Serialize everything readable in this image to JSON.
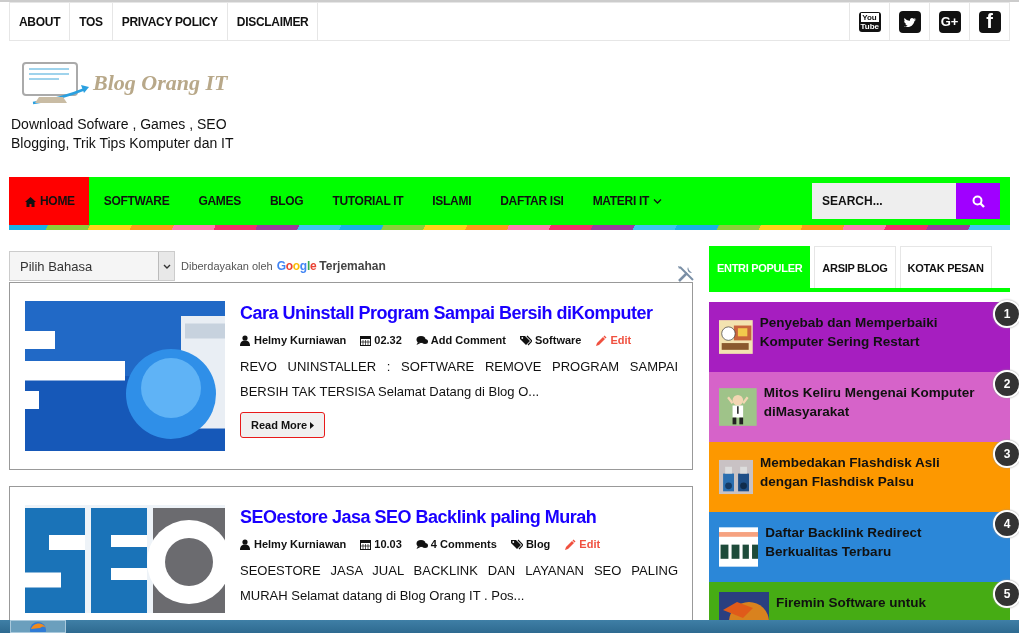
{
  "top_menu": [
    "ABOUT",
    "TOS",
    "PRIVACY POLICY",
    "DISCLAIMER"
  ],
  "social": [
    {
      "kind": "youtube",
      "lines": [
        "You",
        "Tube"
      ]
    },
    {
      "kind": "twitter"
    },
    {
      "kind": "googleplus",
      "text": "G+"
    },
    {
      "kind": "facebook",
      "text": "f"
    }
  ],
  "site": {
    "logo_text": "Blog Orang IT",
    "tagline": "Download Sofware , Games , SEO Blogging, Trik Tips Komputer dan IT"
  },
  "nav": [
    {
      "label": "HOME",
      "selected": true,
      "dropdown": false
    },
    {
      "label": "SOFTWARE",
      "selected": false,
      "dropdown": false
    },
    {
      "label": "GAMES",
      "selected": false,
      "dropdown": false
    },
    {
      "label": "BLOG",
      "selected": false,
      "dropdown": false
    },
    {
      "label": "TUTORIAL IT",
      "selected": false,
      "dropdown": false
    },
    {
      "label": "ISLAMI",
      "selected": false,
      "dropdown": false
    },
    {
      "label": "DAFTAR ISI",
      "selected": false,
      "dropdown": false
    },
    {
      "label": "MATERI IT",
      "selected": false,
      "dropdown": true
    }
  ],
  "search": {
    "placeholder": "SEARCH..."
  },
  "translate": {
    "select": "Pilih Bahasa",
    "powered_by": "Diberdayakan oleh",
    "brand": "Google",
    "link": "Terjemahan"
  },
  "posts": [
    {
      "title": "Cara Uninstall Program Sampai Bersih diKomputer",
      "author": "Helmy Kurniawan",
      "time": "02.32",
      "comments": "Add Comment",
      "label": "Software",
      "edit": "Edit",
      "excerpt": "REVO UNINSTALLER : SOFTWARE REMOVE PROGRAM SAMPAI BERSIH TAK TERSISA Selamat Datang di Blog O...",
      "read_more": "Read More"
    },
    {
      "title": "SEOestore Jasa SEO Backlink paling Murah",
      "author": "Helmy Kurniawan",
      "time": "10.03",
      "comments": "4 Comments",
      "label": "Blog",
      "edit": "Edit",
      "excerpt": "SEOESTORE JASA JUAL BACKLINK DAN LAYANAN SEO PALING MURAH Selamat datang di Blog Orang IT . Pos..."
    }
  ],
  "sidebar_tabs": [
    {
      "label": "ENTRI POPULER",
      "selected": true
    },
    {
      "label": "ARSIP BLOG",
      "selected": false
    },
    {
      "label": "KOTAK PESAN",
      "selected": false
    }
  ],
  "popular": [
    {
      "rank": "1",
      "title": "Penyebab dan Memperbaiki Komputer Sering Restart",
      "color": "#a61ec0"
    },
    {
      "rank": "2",
      "title": "Mitos Keliru Mengenai Komputer diMasyarakat",
      "color": "#d663c9"
    },
    {
      "rank": "3",
      "title": "Membedakan Flashdisk Asli dengan Flashdisk Palsu",
      "color": "#fd9800"
    },
    {
      "rank": "4",
      "title": "Daftar Backlink Redirect Berkualitas Terbaru",
      "color": "#2b87d8"
    },
    {
      "rank": "5",
      "title": "Firemin Software untuk",
      "color": "#46ac14"
    }
  ]
}
